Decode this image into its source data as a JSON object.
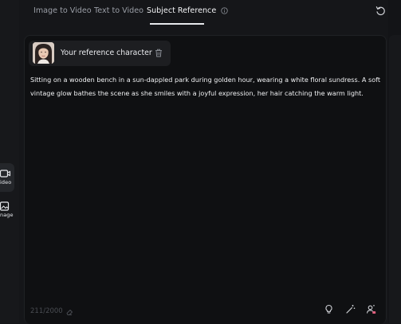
{
  "tabs": [
    {
      "label": "Image to Video",
      "active": false
    },
    {
      "label": "Text to Video",
      "active": false
    },
    {
      "label": "Subject Reference",
      "active": true
    }
  ],
  "sidebar": {
    "items": [
      {
        "label": "ideo",
        "icon": "video-icon"
      },
      {
        "label": "nage",
        "icon": "image-icon"
      }
    ]
  },
  "reference": {
    "label": "Your reference character"
  },
  "prompt": {
    "text": "Sitting on a wooden bench in a sun-dappled park during golden hour, wearing a white floral sundress. A soft vintage glow bathes the scene as she smiles with a joyful expression, her hair catching the warm light."
  },
  "footer": {
    "char_count": "211/2000"
  },
  "colors": {
    "background": "#151619",
    "panel": "#0f1012",
    "active_text": "#f2f3f5",
    "inactive_text": "#9a9ea6"
  }
}
